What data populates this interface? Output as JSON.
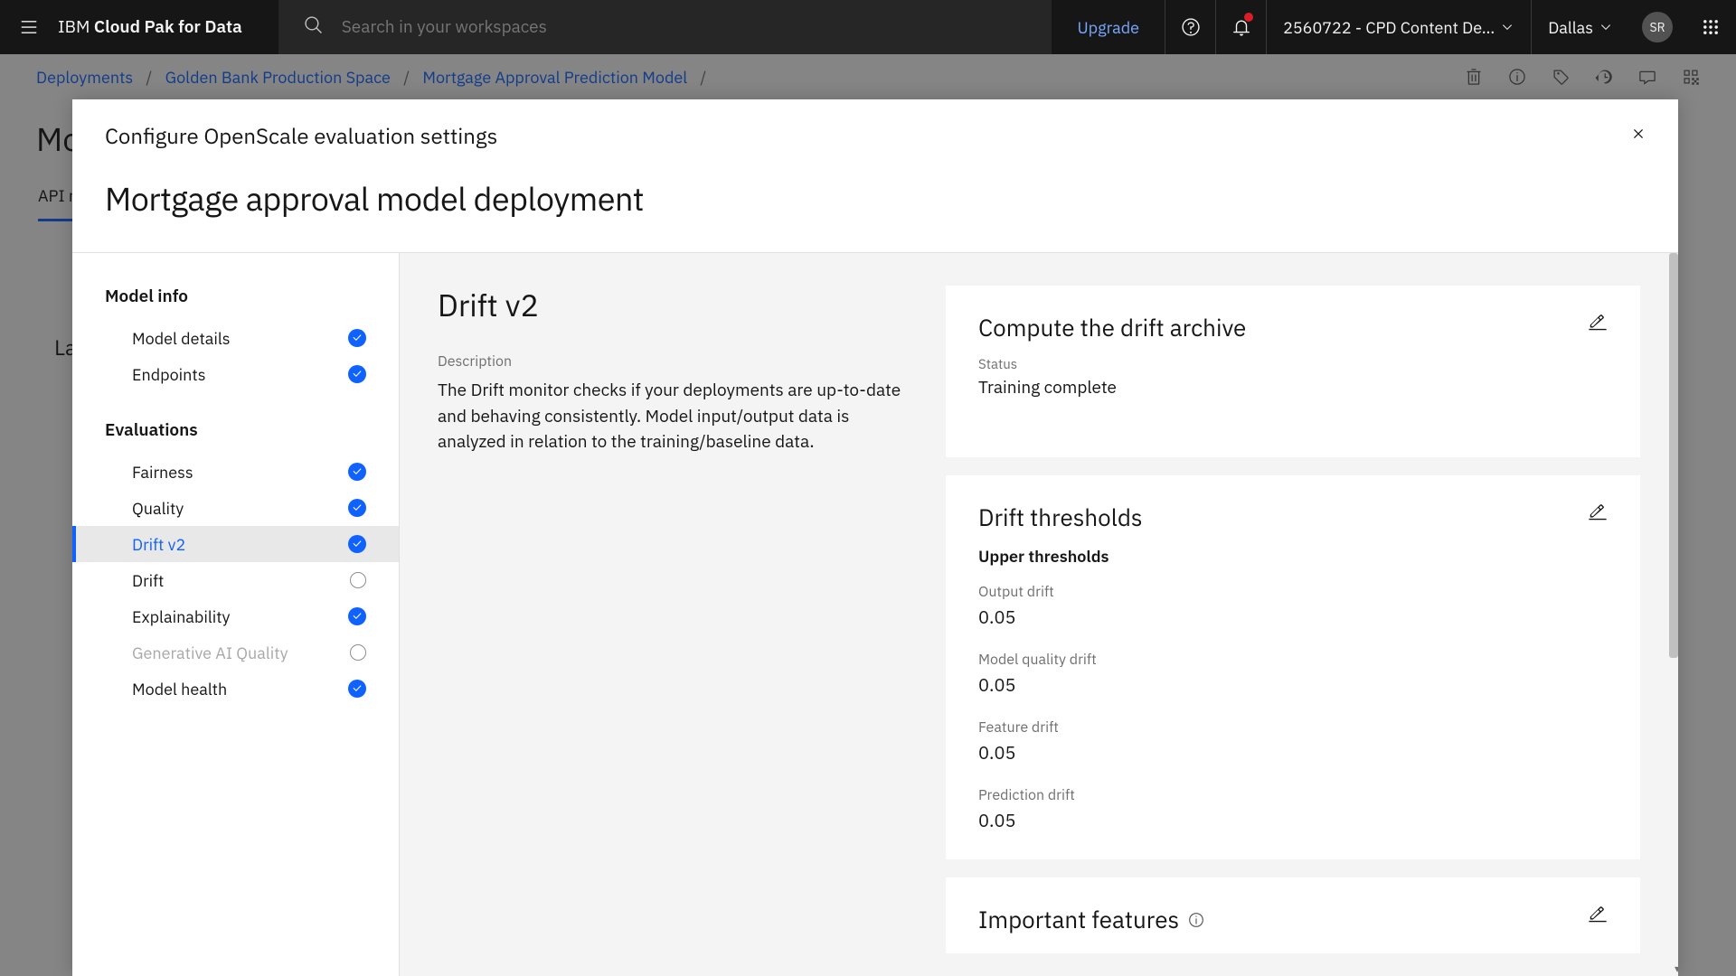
{
  "topnav": {
    "brand_prefix": "IBM ",
    "brand_bold": "Cloud Pak for Data",
    "search_placeholder": "Search in your workspaces",
    "upgrade": "Upgrade",
    "account": "2560722 - CPD Content De…",
    "region": "Dallas",
    "avatar": "SR"
  },
  "breadcrumb": {
    "items": [
      "Deployments",
      "Golden Bank Production Space",
      "Mortgage Approval Prediction Model"
    ]
  },
  "background": {
    "title_fragment": "Mo",
    "tab_fragment": "API r",
    "la_fragment": "La"
  },
  "modal": {
    "subtitle": "Configure OpenScale evaluation settings",
    "title": "Mortgage approval model deployment"
  },
  "sidebar": {
    "group1_label": "Model info",
    "group1_items": [
      {
        "label": "Model details",
        "status": "checked"
      },
      {
        "label": "Endpoints",
        "status": "checked"
      }
    ],
    "group2_label": "Evaluations",
    "group2_items": [
      {
        "label": "Fairness",
        "status": "checked"
      },
      {
        "label": "Quality",
        "status": "checked"
      },
      {
        "label": "Drift v2",
        "status": "checked",
        "selected": true
      },
      {
        "label": "Drift",
        "status": "empty"
      },
      {
        "label": "Explainability",
        "status": "checked"
      },
      {
        "label": "Generative AI Quality",
        "status": "empty",
        "disabled": true
      },
      {
        "label": "Model health",
        "status": "checked"
      }
    ]
  },
  "main": {
    "heading": "Drift v2",
    "desc_label": "Description",
    "desc_text": "The Drift monitor checks if your deployments are up-to-date and behaving consistently. Model input/output data is analyzed in relation to the training/baseline data."
  },
  "cards": {
    "archive": {
      "title": "Compute the drift archive",
      "status_label": "Status",
      "status_value": "Training complete"
    },
    "thresholds": {
      "title": "Drift thresholds",
      "subtitle": "Upper thresholds",
      "metrics": [
        {
          "label": "Output drift",
          "value": "0.05"
        },
        {
          "label": "Model quality drift",
          "value": "0.05"
        },
        {
          "label": "Feature drift",
          "value": "0.05"
        },
        {
          "label": "Prediction drift",
          "value": "0.05"
        }
      ]
    },
    "features": {
      "title": "Important features"
    }
  }
}
